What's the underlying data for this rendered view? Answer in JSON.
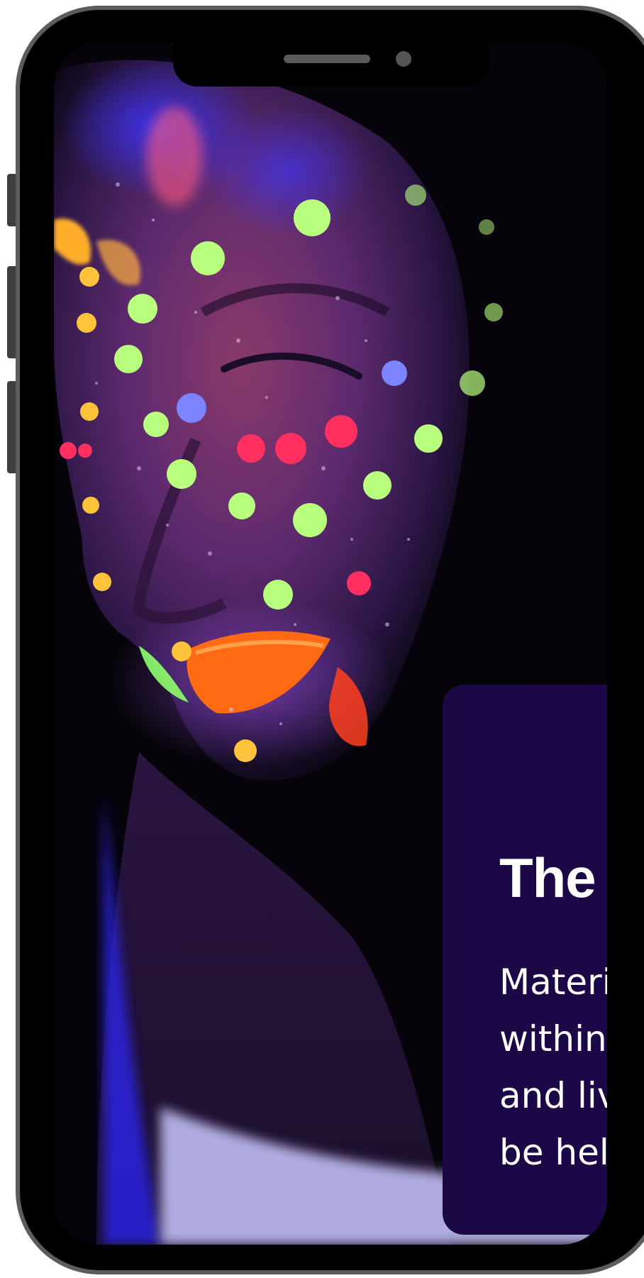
{
  "card": {
    "title": "The Ses",
    "body_lines": [
      "Materials ar",
      "within the x",
      "and live disc",
      "be held on Z"
    ]
  },
  "colors": {
    "frame": "#5c5c5c",
    "card_background": "#1b0845",
    "card_text": "#ffffff"
  },
  "icons": {
    "speaker": "speaker-grille",
    "camera": "front-camera"
  }
}
